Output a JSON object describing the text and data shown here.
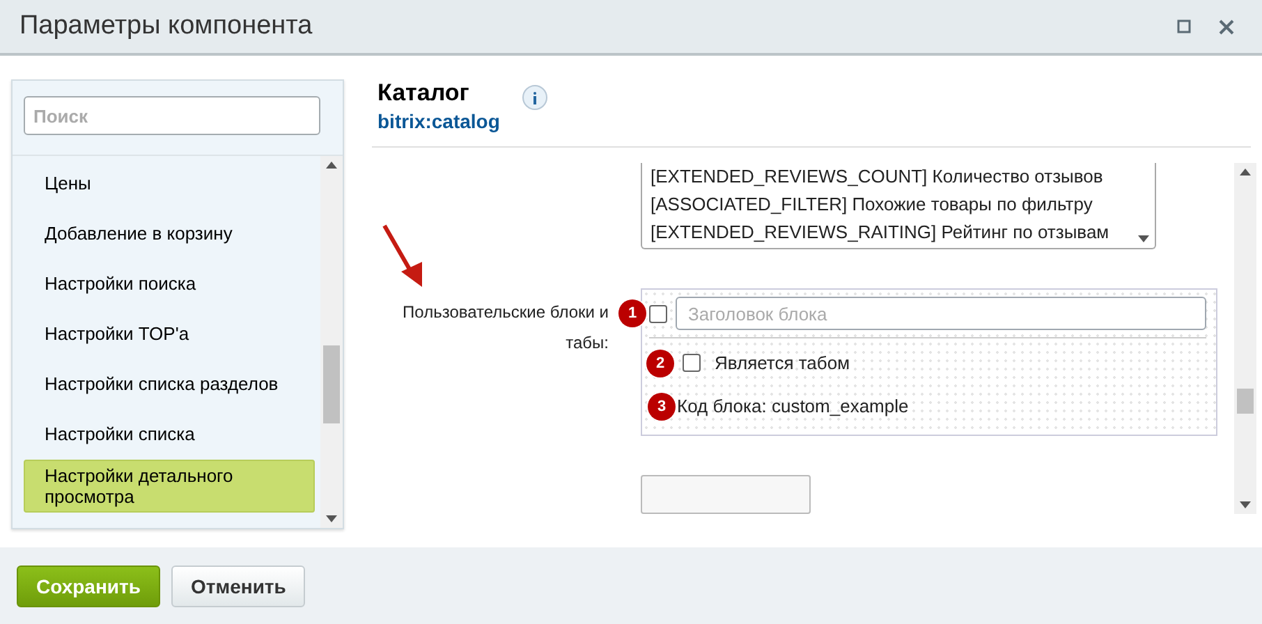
{
  "window": {
    "title": "Параметры компонента"
  },
  "sidebar": {
    "search": {
      "placeholder": "Поиск"
    },
    "items": [
      {
        "label": "Цены",
        "selected": false
      },
      {
        "label": "Добавление в корзину",
        "selected": false
      },
      {
        "label": "Настройки поиска",
        "selected": false
      },
      {
        "label": "Настройки TOP'а",
        "selected": false
      },
      {
        "label": "Настройки списка разделов",
        "selected": false
      },
      {
        "label": "Настройки списка",
        "selected": false
      },
      {
        "label": "Настройки детального просмотра",
        "selected": true
      }
    ]
  },
  "component": {
    "title": "Каталог",
    "code": "bitrix:catalog"
  },
  "settings": {
    "list_options": [
      "[EXTENDED_REVIEWS_COUNT] Количество отзывов",
      "[ASSOCIATED_FILTER] Похожие товары по фильтру",
      "[EXTENDED_REVIEWS_RAITING] Рейтинг по отзывам"
    ],
    "custom_blocks": {
      "label": "Пользовательские блоки и табы:",
      "title_field": {
        "badge": "1",
        "checked": false,
        "placeholder": "Заголовок блока"
      },
      "is_tab": {
        "badge": "2",
        "checked": false,
        "label": "Является табом"
      },
      "code": {
        "badge": "3",
        "text": "Код блока: custom_example"
      }
    }
  },
  "buttons": [
    {
      "label": "Сохранить",
      "kind": "primary"
    },
    {
      "label": "Отменить",
      "kind": "secondary"
    }
  ]
}
